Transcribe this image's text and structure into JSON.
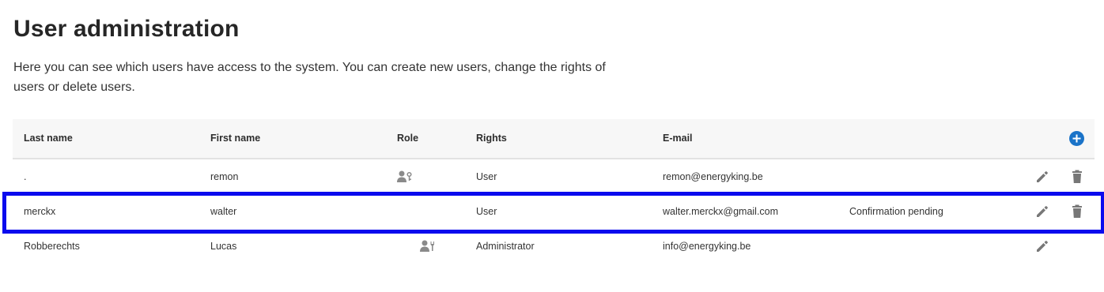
{
  "header": {
    "title": "User administration",
    "description": "Here you can see which users have access to the system. You can create new users, change the rights of users or delete users."
  },
  "table": {
    "columns": {
      "last_name": "Last name",
      "first_name": "First name",
      "role": "Role",
      "rights": "Rights",
      "email": "E-mail"
    },
    "add_icon": "add-circle-icon",
    "rows": [
      {
        "last_name": ".",
        "first_name": "remon",
        "role_icon": "user-key-icon",
        "rights": "User",
        "email": "remon@energyking.be",
        "status": "",
        "actions": [
          "edit",
          "delete"
        ]
      },
      {
        "last_name": "merckx",
        "first_name": "walter",
        "role_icon": "",
        "rights": "User",
        "email": "walter.merckx@gmail.com",
        "status": "Confirmation pending",
        "actions": [
          "edit",
          "delete"
        ]
      },
      {
        "last_name": "Robberechts",
        "first_name": "Lucas",
        "role_icon": "user-key-icon",
        "rights": "Administrator",
        "email": "info@energyking.be",
        "status": "",
        "actions": [
          "edit"
        ]
      }
    ]
  },
  "colors": {
    "accent": "#1a73c8",
    "highlight": "#0a0aee",
    "header_bg": "#f7f7f7",
    "icon": "#777777"
  }
}
